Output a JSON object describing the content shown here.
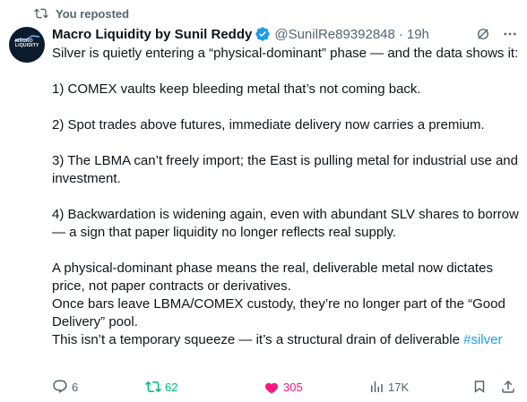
{
  "repost": {
    "label": "You reposted"
  },
  "author": {
    "display_name": "Macro Liquidity by Sunil Reddy",
    "handle": "@SunilRe89392848",
    "separator": "·",
    "time": "19h",
    "avatar_text_line1": "MACRO",
    "avatar_text_line2": "LIQUIDITY"
  },
  "tweet": {
    "text": "Silver is quietly entering a “physical-dominant” phase — and the data shows it:\n\n1) COMEX vaults keep bleeding metal that’s not coming back.\n\n2) Spot trades above futures, immediate delivery now carries a premium.\n\n3) The LBMA can’t freely import; the East is pulling metal for industrial use and investment.\n\n4) Backwardation is widening again, even with abundant SLV shares to borrow — a sign that paper liquidity no longer reflects real supply.\n\nA physical-dominant phase means the real, deliverable metal now dictates price, not paper contracts or derivatives.\nOnce bars leave LBMA/COMEX custody, they’re no longer part of the “Good Delivery” pool.\nThis isn’t a temporary squeeze — it’s a structural drain of deliverable ",
    "hashtag": "#silver"
  },
  "actions": {
    "replies": "6",
    "reposts": "62",
    "likes": "305",
    "views": "17K"
  },
  "colors": {
    "accent": "#1d9bf0",
    "repost_green": "#00ba7c",
    "like_pink": "#f91880",
    "muted": "#536471"
  }
}
